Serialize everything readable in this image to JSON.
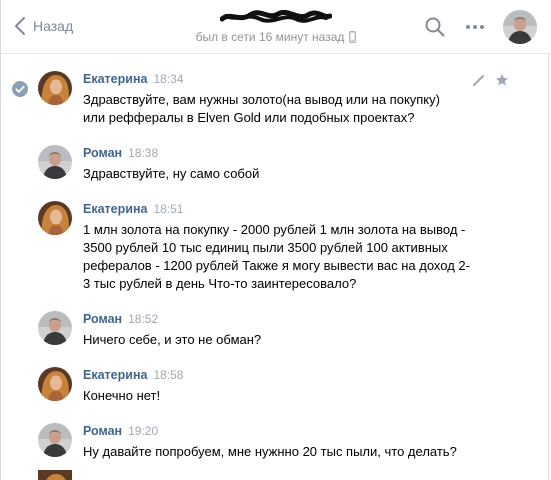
{
  "header": {
    "back_label": "Назад",
    "status": "был в сети 16 минут назад",
    "icons": [
      "back-chevron-icon",
      "redacted-name",
      "mobile-phone-icon",
      "search-icon",
      "more-dots-icon",
      "avatar"
    ]
  },
  "messages": [
    {
      "name": "Екатерина",
      "time": "18:34",
      "text": "Здравствуйте, вам нужны золото(на вывод или на покупку)\nили рефферaлы в Elven Gold или подобных проектах?"
    },
    {
      "name": "Роман",
      "time": "18:38",
      "text": "Здравствуйте, ну само собой"
    },
    {
      "name": "Екатерина",
      "time": "18:51",
      "text": "1 млн золота на покупку - 2000 рублей 1 млн золота на вывод -\n3500 рублей 10 тыс единиц пыли 3500 рублей 100 активных\nрефералов - 1200 рублей Также я могу вывести вас на доход 2-\n3 тыс рублей в день Что-то заинтересовало?"
    },
    {
      "name": "Роман",
      "time": "18:52",
      "text": "Ничего себе, и это не обман?"
    },
    {
      "name": "Екатерина",
      "time": "18:58",
      "text": "Конечно нет!"
    },
    {
      "name": "Роман",
      "time": "19:20",
      "text": "Ну давайте попробуем, мне нужнно 20 тыс пыли, что делать?"
    }
  ],
  "colors": {
    "name": "#42648b",
    "time": "#a0a8b3",
    "status": "#939393",
    "back": "#828a99",
    "divider": "#e3e6ea"
  }
}
